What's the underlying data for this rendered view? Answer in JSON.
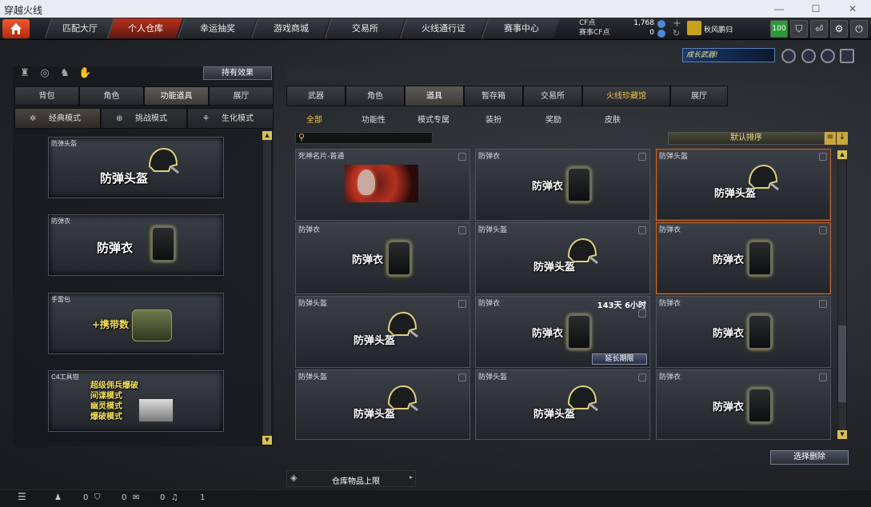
{
  "window": {
    "title": "穿越火线"
  },
  "nav": {
    "tabs": [
      "匹配大厅",
      "个人仓库",
      "幸运抽奖",
      "游戏商城",
      "交易所",
      "火线通行证",
      "赛事中心"
    ]
  },
  "currency": {
    "cf_label": "CF点",
    "cf_value": "1,768",
    "match_cf_label": "赛事CF点",
    "match_cf_value": "0"
  },
  "user": {
    "name": "秋风鹏归",
    "level": "100"
  },
  "left": {
    "effects_button": "持有效果",
    "tabs": [
      "背包",
      "角色",
      "功能道具",
      "展厅"
    ],
    "modes": [
      "经典模式",
      "挑战模式",
      "生化模式"
    ],
    "items": [
      {
        "label": "防弹头盔",
        "text": "防弹头盔"
      },
      {
        "label": "防弹衣",
        "text": "防弹衣"
      },
      {
        "label": "手雷包",
        "text": "+携带数"
      },
      {
        "label": "C4工具钳",
        "text": "超级佣兵爆破\n间谍模式\n幽灵模式\n爆破模式"
      }
    ]
  },
  "promo": {
    "text": "成长武器!"
  },
  "right": {
    "tabs": [
      "武器",
      "角色",
      "道具",
      "暂存箱",
      "交易所",
      "火线珍藏馆",
      "展厅"
    ],
    "subtabs": [
      "全部",
      "功能性",
      "模式专属",
      "装扮",
      "奖励",
      "皮肤"
    ],
    "sort_label": "默认排序",
    "grid": [
      {
        "name": "死神名片-普通",
        "kind": "card"
      },
      {
        "name": "防弹衣",
        "text": "防弹衣",
        "kind": "vest"
      },
      {
        "name": "防弹头盔",
        "text": "防弹头盔",
        "kind": "helm",
        "sel": true
      },
      {
        "name": "防弹衣",
        "text": "防弹衣",
        "kind": "vest"
      },
      {
        "name": "防弹头盔",
        "text": "防弹头盔",
        "kind": "helm"
      },
      {
        "name": "防弹衣",
        "text": "防弹衣",
        "kind": "vest",
        "sel": true
      },
      {
        "name": "防弹头盔",
        "text": "防弹头盔",
        "kind": "helm"
      },
      {
        "name": "防弹衣",
        "text": "防弹衣",
        "kind": "vest",
        "time": "143天 6小时",
        "extend": "延长期限"
      },
      {
        "name": "防弹衣",
        "text": "防弹衣",
        "kind": "vest"
      },
      {
        "name": "防弹头盔",
        "text": "防弹头盔",
        "kind": "helm"
      },
      {
        "name": "防弹头盔",
        "text": "防弹头盔",
        "kind": "helm"
      },
      {
        "name": "防弹衣",
        "text": "防弹衣",
        "kind": "vest"
      }
    ],
    "delete_button": "选择删除",
    "capacity": "仓库物品上限"
  },
  "status": {
    "v1": "0",
    "v2": "0",
    "v3": "0",
    "v4": "1"
  }
}
